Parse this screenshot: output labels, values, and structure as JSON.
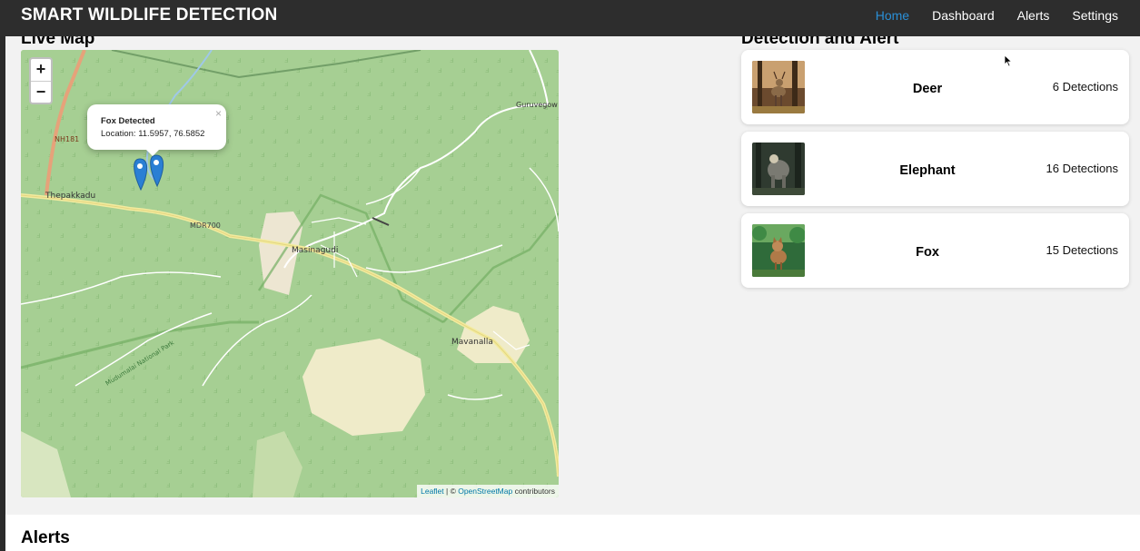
{
  "app": {
    "title": "SMART WILDLIFE DETECTION"
  },
  "nav": {
    "items": [
      {
        "label": "Home",
        "active": true
      },
      {
        "label": "Dashboard"
      },
      {
        "label": "Alerts"
      },
      {
        "label": "Settings"
      }
    ]
  },
  "map": {
    "title": "Live Map",
    "zoom_in": "+",
    "zoom_out": "−",
    "popup": {
      "title": "Fox Detected",
      "location": "Location: 11.5957, 76.5852",
      "close": "×"
    },
    "labels": {
      "nh181": "NH181",
      "thepakkadu": "Thepakkadu",
      "mdr700": "MDR700",
      "masinagudi": "Masinagudi",
      "mavanalla": "Mavanalla",
      "guruvego": "Guruvegow",
      "park": "Mudumalai National Park"
    },
    "attribution": {
      "leaflet": "Leaflet",
      "sep": " | © ",
      "osm": "OpenStreetMap",
      "suffix": " contributors"
    },
    "colors": {
      "forest": "#a6cf93",
      "road_major": "#f3eb9e",
      "river": "#ffffff",
      "marker": "#2a7fd4"
    }
  },
  "detections": {
    "title": "Detection and Alert",
    "items": [
      {
        "name": "Deer",
        "count": "6 Detections",
        "icon": "deer-photo"
      },
      {
        "name": "Elephant",
        "count": "16 Detections",
        "icon": "elephant-photo"
      },
      {
        "name": "Fox",
        "count": "15 Detections",
        "icon": "fox-photo"
      }
    ]
  },
  "alerts": {
    "title": "Alerts"
  }
}
